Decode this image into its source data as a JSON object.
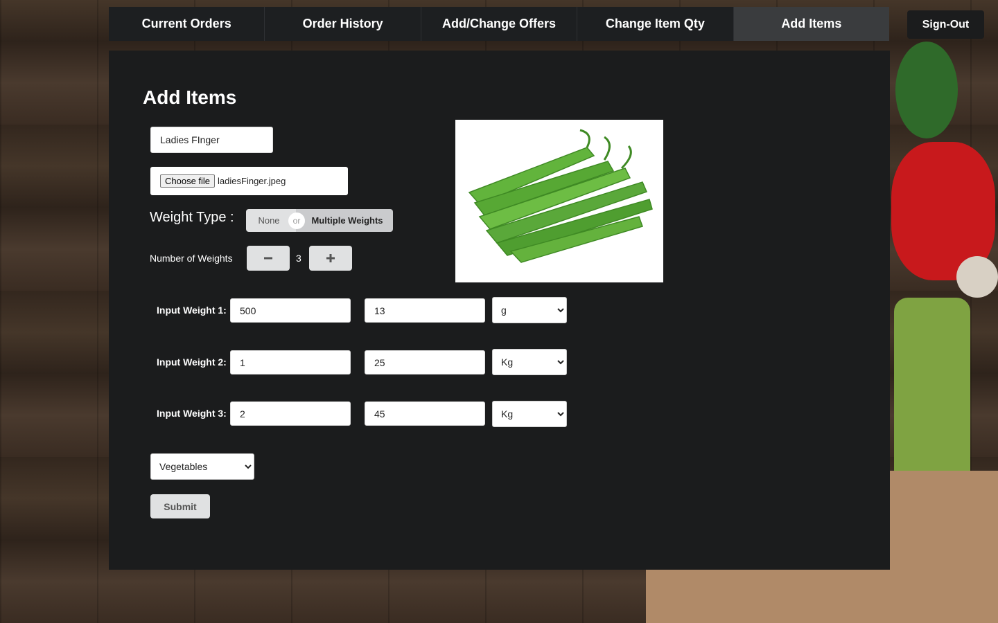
{
  "nav": {
    "tabs": [
      {
        "label": "Current Orders"
      },
      {
        "label": "Order History"
      },
      {
        "label": "Add/Change Offers"
      },
      {
        "label": "Change Item Qty"
      },
      {
        "label": "Add Items"
      }
    ],
    "active_tab": "Add Items",
    "signout_label": "Sign-Out"
  },
  "form": {
    "title": "Add Items",
    "item_name": "Ladies FInger",
    "file_button_label": "Choose file",
    "file_name": "ladiesFinger.jpeg",
    "weight_type_label": "Weight Type :",
    "weight_type_options": [
      "None",
      "Multiple Weights"
    ],
    "weight_type_or": "or",
    "weight_type_selected": "Multiple Weights",
    "number_of_weights_label": "Number of Weights",
    "number_of_weights": "3",
    "weights": [
      {
        "label": "Input Weight 1:",
        "weight": "500",
        "price": "13",
        "unit": "g"
      },
      {
        "label": "Input Weight 2:",
        "weight": "1",
        "price": "25",
        "unit": "Kg"
      },
      {
        "label": "Input Weight 3:",
        "weight": "2",
        "price": "45",
        "unit": "Kg"
      }
    ],
    "category": "Vegetables",
    "submit_label": "Submit"
  },
  "colors": {
    "panel": "#1b1c1d",
    "nav": "#1d1f21",
    "button": "#e0e1e2",
    "okra_green": "#5aa83a"
  },
  "icons": {
    "minus": "minus-icon",
    "plus": "plus-icon",
    "dropdown": "chevron-down-icon"
  }
}
